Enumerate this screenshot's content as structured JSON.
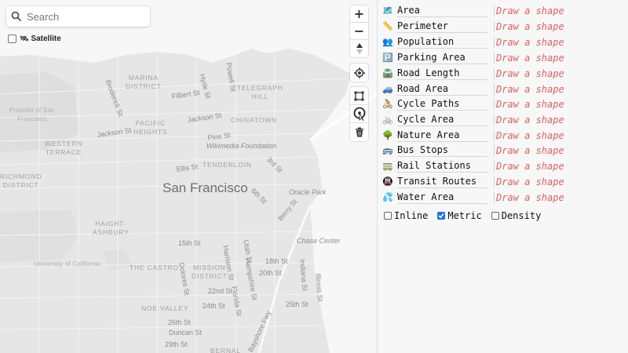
{
  "search": {
    "placeholder": "Search"
  },
  "satellite": {
    "label": "Satellite",
    "checked": false,
    "icon": "🛰"
  },
  "map_controls": {
    "zoom_in": "+",
    "zoom_out": "−",
    "compass": "▲▼",
    "geolocate": "geolocate-icon",
    "tools": [
      "draw-polygon-icon",
      "draw-circle-icon",
      "trash-icon"
    ]
  },
  "map_labels": {
    "city": "San Francisco",
    "districts": {
      "marina": [
        "MARINA",
        "DISTRICT"
      ],
      "telegraph": [
        "TELEGRAPH",
        "HILL"
      ],
      "pacific": [
        "PACIFIC",
        "HEIGHTS"
      ],
      "chinatown": "CHINATOWN",
      "western": [
        "WESTERN",
        "TERRACE"
      ],
      "tenderloin": "TENDERLOIN",
      "richmond": [
        "RICHMOND",
        "DISTRICT"
      ],
      "haight": [
        "HAIGHT-",
        "ASHBURY"
      ],
      "castro": "THE CASTRO",
      "mission": [
        "MISSION",
        "DISTRICT"
      ],
      "noe": "NOE VALLEY",
      "bernal": "BERNAL"
    },
    "green": {
      "presidio": [
        "Presidio of San",
        "Francisco"
      ],
      "ucsf": "University of California"
    },
    "poi": {
      "wikimedia": "Wikimedia Foundation",
      "oracle": "Oracle Park",
      "chase": "Chase Center"
    },
    "streets": {
      "broderick": "Broderick St",
      "hyde": "Hyde St",
      "powell": "Powell St",
      "filbert": "Filbert St",
      "jackson_w": "Jackson St",
      "jackson_e": "Jackson St",
      "pine": "Pine St",
      "ellis": "Ellis St",
      "third": "3rd St",
      "sixth": "6th St",
      "berry": "Berry St",
      "fifteenth": "15th St",
      "utah": "Utah St",
      "harrison": "Harrison St",
      "eighteenth": "18th St",
      "dolores": "Dolores St",
      "hampshire": "Hampshire St",
      "twentieth": "20th St",
      "indiana": "Indiana St",
      "illinois": "Illinois St",
      "twentysecond": "22nd St",
      "florida": "Florida St",
      "twentyfourth": "24th St",
      "twentyfifth": "25th St",
      "twentysixth": "26th St",
      "duncan": "Duncan St",
      "twentyninth": "29th St",
      "bayshore": "Bayshore Fwy"
    }
  },
  "measures": [
    {
      "icon": "🗺️",
      "label": "Area",
      "value": "Draw a shape"
    },
    {
      "icon": "📏",
      "label": "Perimeter",
      "value": "Draw a shape"
    },
    {
      "icon": "👥",
      "label": "Population",
      "value": "Draw a shape"
    },
    {
      "icon": "🅿️",
      "label": "Parking Area",
      "value": "Draw a shape"
    },
    {
      "icon": "🛣️",
      "label": "Road Length",
      "value": "Draw a shape"
    },
    {
      "icon": "🚙",
      "label": "Road Area",
      "value": "Draw a shape"
    },
    {
      "icon": "🚴",
      "label": "Cycle Paths",
      "value": "Draw a shape"
    },
    {
      "icon": "🚲",
      "label": "Cycle Area",
      "value": "Draw a shape"
    },
    {
      "icon": "🌳",
      "label": "Nature Area",
      "value": "Draw a shape"
    },
    {
      "icon": "🚌",
      "label": "Bus Stops",
      "value": "Draw a shape"
    },
    {
      "icon": "🚃",
      "label": "Rail Stations",
      "value": "Draw a shape"
    },
    {
      "icon": "🚇",
      "label": "Transit Routes",
      "value": "Draw a shape"
    },
    {
      "icon": "💦",
      "label": "Water Area",
      "value": "Draw a shape"
    }
  ],
  "options": [
    {
      "label": "Inline",
      "checked": false
    },
    {
      "label": "Metric",
      "checked": true
    },
    {
      "label": "Density",
      "checked": false
    }
  ],
  "colors": {
    "value_text": "#e06262",
    "checkbox_on": "#1a73e8",
    "map_land": "#e9e9e9",
    "map_water": "#f6f6f6"
  }
}
